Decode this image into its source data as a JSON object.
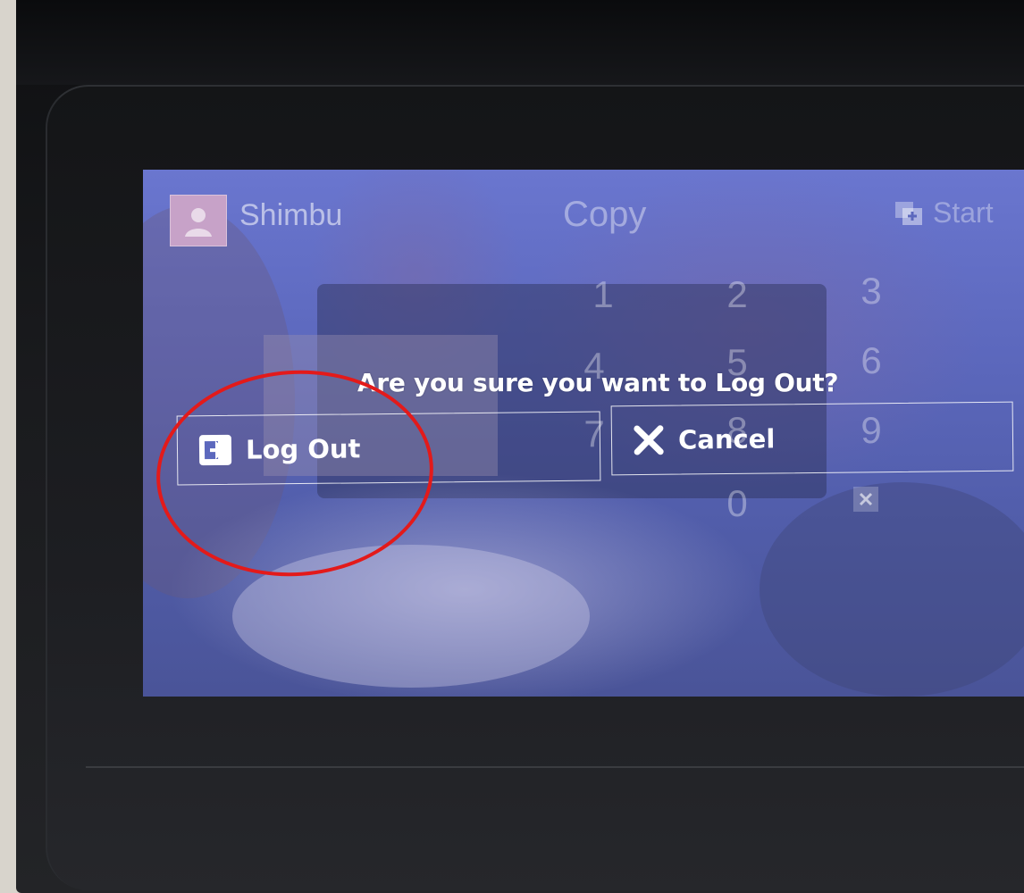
{
  "header": {
    "username": "Shimbu",
    "app_title": "Copy",
    "start_label": "Start"
  },
  "keypad": [
    "1",
    "2",
    "3",
    "4",
    "5",
    "6",
    "7",
    "8",
    "9",
    "0"
  ],
  "dialog": {
    "message": "Are you sure you want to Log Out?",
    "logout_label": "Log Out",
    "cancel_label": "Cancel"
  },
  "icons": {
    "avatar": "user-avatar-icon",
    "start": "start-icon",
    "logout": "logout-icon",
    "cancel": "close-x-icon",
    "backspace": "backspace-icon"
  },
  "colors": {
    "screen": "#5c68bd",
    "annotation": "#e31a1a"
  }
}
